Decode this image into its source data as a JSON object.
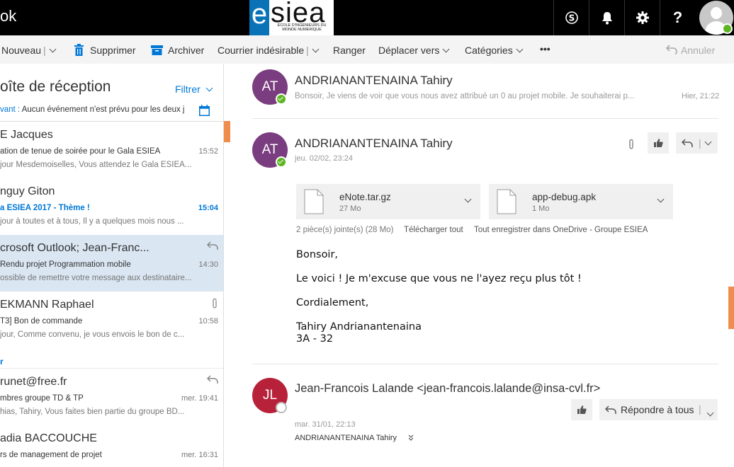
{
  "app": {
    "title_fragment": "ok"
  },
  "logo": {
    "letter": "e",
    "word": "siea",
    "tagline": "ECOLE D'INGENIEURS DU MONDE NUMERIQUE"
  },
  "topbar": {
    "icons": [
      "skype-icon",
      "bell-icon",
      "gear-icon",
      "help-icon"
    ],
    "help_label": "?"
  },
  "toolbar": {
    "new_label": "Nouveau",
    "delete_label": "Supprimer",
    "archive_label": "Archiver",
    "junk_label": "Courrier indésirable",
    "sweep_label": "Ranger",
    "move_label": "Déplacer vers",
    "categories_label": "Catégories",
    "more_label": "•••",
    "undo_label": "Annuler",
    "separator": "|"
  },
  "inbox": {
    "title": "oîte de réception",
    "filter_label": "Filtrer",
    "agenda_label": "vant :",
    "agenda_text": "Aucun événement n'est prévu pour les deux j",
    "group_yesterday": "r"
  },
  "messages": [
    {
      "from": "E Jacques",
      "subject": "ation de tenue de soirée pour le Gala ESIEA",
      "preview": "jour Mesdemoiselles,  Vous attendez le Gala ESIEA...",
      "time": "15:52",
      "unread": false,
      "selected": false,
      "icon": ""
    },
    {
      "from": "nguy Giton",
      "subject": "a ESIEA 2017 - Thème !",
      "preview": "jour à toutes et à tous,  Il y a quelques mois nous ...",
      "time": "15:04",
      "unread": true,
      "selected": false,
      "icon": ""
    },
    {
      "from": "crosoft Outlook; Jean-Franc...",
      "subject": "Rendu projet Programmation mobile",
      "preview": "ossible de remettre votre message aux destinataire...",
      "time": "14:30",
      "unread": false,
      "selected": true,
      "icon": "reply-icon"
    },
    {
      "from": "EKMANN Raphael",
      "subject": "T3] Bon de commande",
      "preview": "jour,   Comme convenu, je vous envois le bon de c...",
      "time": "10:58",
      "unread": false,
      "selected": false,
      "icon": "paperclip-icon"
    },
    {
      "from": "runet@free.fr",
      "subject": "mbres groupe TD & TP",
      "preview": "hias, Tahiry,  Vous faites bien partie du groupe BD...",
      "time": "mer. 19:41",
      "unread": false,
      "selected": false,
      "icon": "reply-icon"
    },
    {
      "from": "adia BACCOUCHE",
      "subject": "rs de management de projet",
      "preview": "",
      "time": "mer. 16:31",
      "unread": false,
      "selected": false,
      "icon": ""
    }
  ],
  "thread": [
    {
      "initials": "AT",
      "avatar_color": "#7a3d7f",
      "presence": "online",
      "sender": "ANDRIANANTENAINA Tahiry",
      "preview": "Bonsoir, Je viens de voir que vous nous avez attribué un 0 au projet mobile. Je souhaiterai p...",
      "time": "Hier, 21:22"
    },
    {
      "initials": "AT",
      "avatar_color": "#7a3d7f",
      "presence": "online",
      "sender": "ANDRIANANTENAINA Tahiry",
      "time": "jeu. 02/02, 23:24",
      "attachments": [
        {
          "name": "eNote.tar.gz",
          "size": "27 Mo"
        },
        {
          "name": "app-debug.apk",
          "size": "1 Mo"
        }
      ],
      "attachment_summary": "2 pièce(s) jointe(s) (28 Mo)",
      "download_all": "Télécharger tout",
      "save_onedrive": "Tout enregistrer dans OneDrive - Groupe ESIEA",
      "body": {
        "greeting": "Bonsoir,",
        "line1": "Le voici ! Je m'excuse que vous ne l'ayez reçu plus tôt !",
        "closing": "Cordialement,",
        "sig_name": "Tahiry Andrianantenaina",
        "sig_class": "3A - 32"
      }
    },
    {
      "initials": "JL",
      "avatar_color": "#b8213a",
      "presence": "offline",
      "sender": "Jean-Francois Lalande <jean-francois.lalande@insa-cvl.fr>",
      "time": "mar. 31/01, 22:13",
      "to": "ANDRIANANTENAINA Tahiry",
      "reply_all_label": "Répondre à tous"
    }
  ],
  "colors": {
    "accent": "#0078d7",
    "selected_row": "#dae6f2",
    "unread_marker": "#f08d4d",
    "topbar": "#000000",
    "presence_online": "#5db521"
  }
}
